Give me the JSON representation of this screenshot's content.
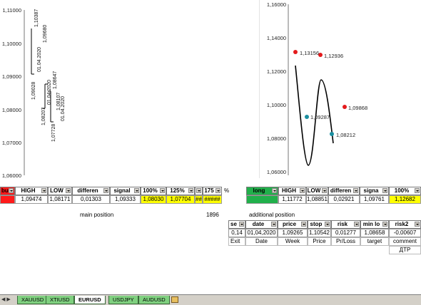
{
  "charts": {
    "left": {
      "y_ticks": [
        "1,11000",
        "1,10000",
        "1,09000",
        "1,08000",
        "1,07000",
        "1,06000"
      ],
      "bar_labels": [
        "1,10387",
        "1,09680",
        "01.04.2020",
        "1,09028",
        "1,08647",
        "01.04.2020",
        "1,08207",
        "1,08107",
        "01.04.2020",
        "1,07728"
      ]
    },
    "right": {
      "y_ticks": [
        "1,16000",
        "1,14000",
        "1,12000",
        "1,10000",
        "1,08000",
        "1,06000"
      ],
      "point_labels": [
        "1,13156",
        "1,12936",
        "1,09287",
        "1,09868",
        "1,08212"
      ],
      "colors": {
        "red_point": "#e41a1c",
        "teal_point": "#1a8fa0",
        "curve": "#000000"
      }
    }
  },
  "left_table": {
    "headers": [
      "bu",
      "HIGH",
      "LOW",
      "differen",
      "signal",
      "100%",
      "125%",
      "",
      "175",
      "%"
    ],
    "row": [
      "",
      "1,09474",
      "1,08171",
      "0,01303",
      "1,09333",
      "1,08030",
      "1,07704",
      "##",
      "#####",
      ""
    ]
  },
  "right_table": {
    "headers": [
      "long",
      "HIGH",
      "LOW",
      "differen",
      "signa",
      "100%"
    ],
    "row": [
      "",
      "1,11772",
      "1,08851",
      "0,02921",
      "1,09761",
      "1,12682"
    ]
  },
  "labels": {
    "main_position": "main position",
    "main_value": "1896",
    "additional_position": "additional position"
  },
  "additional_table": {
    "headers": [
      "se",
      "date",
      "price",
      "stop",
      "risk",
      "min lo",
      "risk2"
    ],
    "row": [
      "0,14",
      "01,04,2020",
      "1,09265",
      "1,10542",
      "0,01277",
      "1,08658",
      "-0,00607"
    ],
    "footer": [
      "Exit",
      "Date",
      "Week",
      "Price",
      "Pr/Loss",
      "target",
      "comment"
    ],
    "extra": "ДТР"
  },
  "sheet_tabs": [
    "XAUUSD",
    "XTIUSD",
    "EURUSD",
    "USDJPY",
    "AUDUSD"
  ],
  "active_tab": "EURUSD",
  "colors": {
    "accent_red": "#ff1a1a",
    "accent_green": "#21b04b",
    "highlight_yellow": "#ffff00",
    "tab_green": "#7fd07f"
  }
}
